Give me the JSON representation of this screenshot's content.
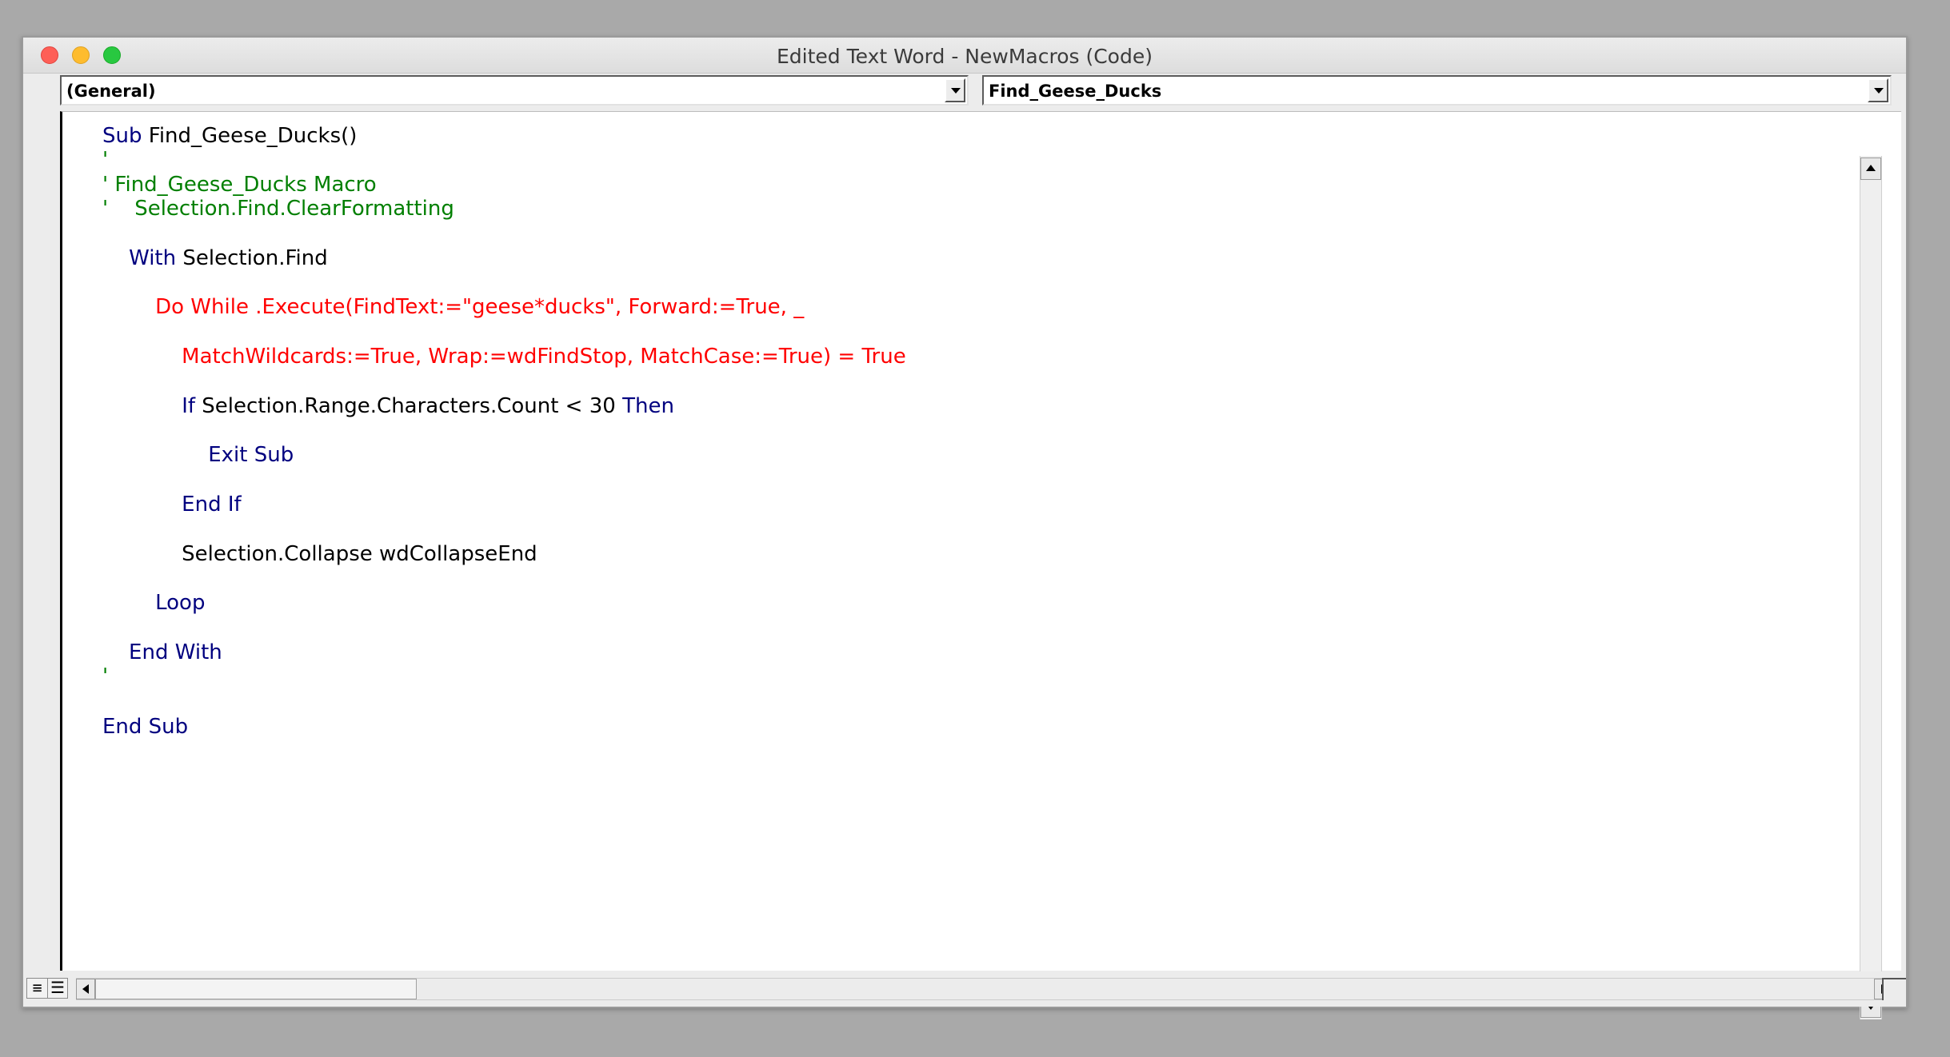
{
  "window": {
    "title": "Edited Text Word - NewMacros (Code)"
  },
  "object_combo": {
    "value": "(General)"
  },
  "procedure_combo": {
    "value": "Find_Geese_Ducks"
  },
  "code": {
    "lines": [
      {
        "parts": [
          {
            "text": "Sub",
            "style": "kw"
          },
          {
            "text": " Find_Geese_Ducks()",
            "style": "plain"
          }
        ]
      },
      {
        "parts": [
          {
            "text": "'",
            "style": "cm"
          }
        ]
      },
      {
        "parts": [
          {
            "text": "' Find_Geese_Ducks Macro",
            "style": "cm"
          }
        ]
      },
      {
        "parts": [
          {
            "text": "'    Selection.Find.ClearFormatting",
            "style": "cm"
          }
        ]
      },
      {
        "parts": []
      },
      {
        "parts": [
          {
            "text": "    ",
            "style": "plain"
          },
          {
            "text": "With",
            "style": "kw"
          },
          {
            "text": " Selection.Find",
            "style": "plain"
          }
        ]
      },
      {
        "parts": []
      },
      {
        "parts": [
          {
            "text": "        Do While .Execute(FindText:=\"geese*ducks\", Forward:=True, _",
            "style": "er"
          }
        ]
      },
      {
        "parts": []
      },
      {
        "parts": [
          {
            "text": "            MatchWildcards:=True, Wrap:=wdFindStop, MatchCase:=True) = True",
            "style": "er"
          }
        ]
      },
      {
        "parts": []
      },
      {
        "parts": [
          {
            "text": "            ",
            "style": "plain"
          },
          {
            "text": "If",
            "style": "kw"
          },
          {
            "text": " Selection.Range.Characters.Count < 30 ",
            "style": "plain"
          },
          {
            "text": "Then",
            "style": "kw"
          }
        ]
      },
      {
        "parts": []
      },
      {
        "parts": [
          {
            "text": "                Exit Sub",
            "style": "kw"
          }
        ]
      },
      {
        "parts": []
      },
      {
        "parts": [
          {
            "text": "            End If",
            "style": "kw"
          }
        ]
      },
      {
        "parts": []
      },
      {
        "parts": [
          {
            "text": "            Selection.Collapse wdCollapseEnd",
            "style": "plain"
          }
        ]
      },
      {
        "parts": []
      },
      {
        "parts": [
          {
            "text": "        Loop",
            "style": "kw"
          }
        ]
      },
      {
        "parts": []
      },
      {
        "parts": [
          {
            "text": "    End With",
            "style": "kw"
          }
        ]
      },
      {
        "parts": [
          {
            "text": "'",
            "style": "cm"
          }
        ]
      },
      {
        "parts": []
      },
      {
        "parts": [
          {
            "text": "End Sub",
            "style": "kw"
          }
        ]
      }
    ]
  },
  "colors": {
    "keyword": "#00007f",
    "comment": "#007f00",
    "error": "#ff0000",
    "plain": "#000000"
  },
  "icons": {
    "procedure_view": "procedure-view-icon",
    "full_module_view": "full-module-view-icon"
  }
}
